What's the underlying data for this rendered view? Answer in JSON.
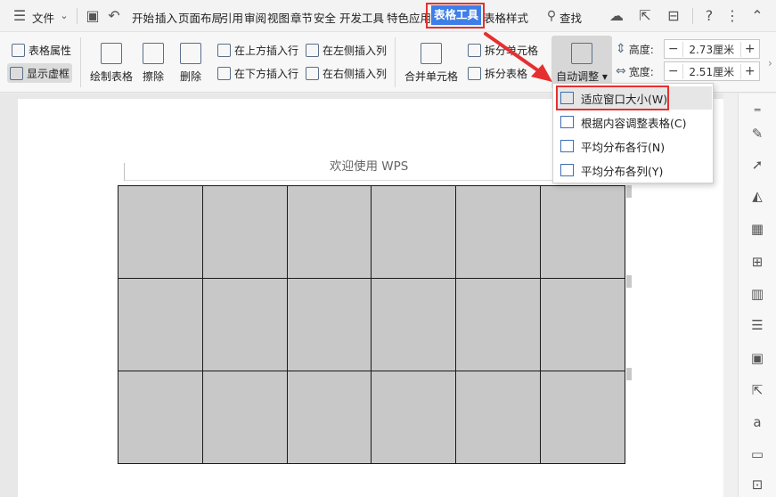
{
  "menubar": {
    "file_label": "文件",
    "tabs": [
      "开始",
      "插入",
      "页面布局",
      "引用",
      "审阅",
      "视图",
      "章节",
      "安全",
      "开发工具",
      "特色应用"
    ],
    "active_tab": "表格工具",
    "tab_after": "表格样式",
    "search_label": "查找"
  },
  "ribbon": {
    "table_props": "表格属性",
    "show_gridlines": "显示虚框",
    "draw_table": "绘制表格",
    "erase": "擦除",
    "delete": "删除",
    "insert_above": "在上方插入行",
    "insert_below": "在下方插入行",
    "insert_left": "在左侧插入列",
    "insert_right": "在右侧插入列",
    "merge_cells": "合并单元格",
    "split_cells": "拆分单元格",
    "split_table": "拆分表格",
    "auto_fit": "自动调整",
    "height_label": "高度:",
    "height_value": "2.73厘米",
    "width_label": "宽度:",
    "width_value": "2.51厘米",
    "minus": "−",
    "plus": "+"
  },
  "document": {
    "header_text": "欢迎使用 WPS",
    "table_rows": 3,
    "table_cols": 6,
    "cell_color": "#c8c8c8"
  },
  "dropdown": {
    "items": [
      {
        "label": "适应窗口大小(W)",
        "icon": "fit-window-icon"
      },
      {
        "label": "根据内容调整表格(C)",
        "icon": "fit-content-icon"
      },
      {
        "label": "平均分布各行(N)",
        "icon": "distribute-rows-icon"
      },
      {
        "label": "平均分布各列(Y)",
        "icon": "distribute-columns-icon"
      }
    ]
  },
  "colors": {
    "accent": "#3d7ee8",
    "highlight_border": "#e53030"
  }
}
